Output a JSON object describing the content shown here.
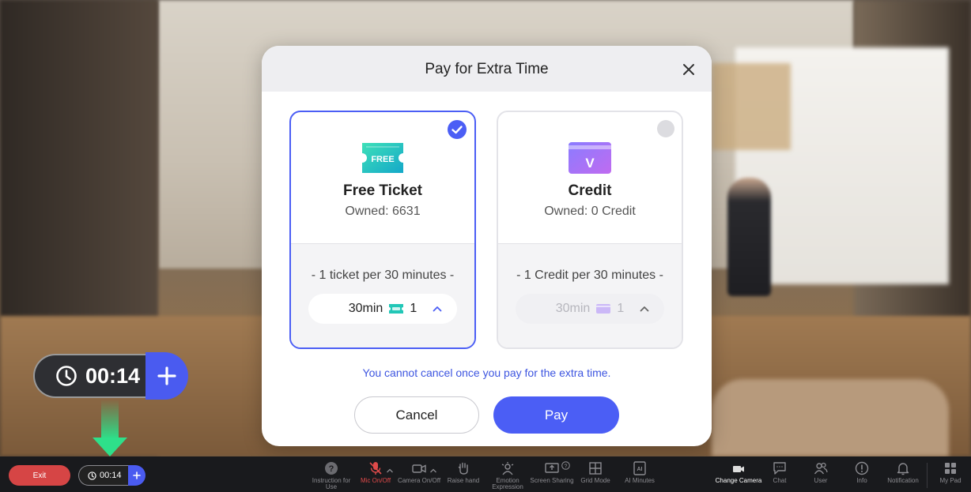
{
  "modal": {
    "title": "Pay for Extra Time",
    "options": [
      {
        "icon": "free-ticket-icon",
        "badge": "FREE",
        "name": "Free Ticket",
        "owned": "Owned: 6631",
        "rate": "- 1 ticket per 30 minutes -",
        "duration": "30min",
        "quantity": "1",
        "selected": true
      },
      {
        "icon": "credit-icon",
        "badge": "V",
        "name": "Credit",
        "owned": "Owned: 0 Credit",
        "rate": "- 1 Credit per 30 minutes -",
        "duration": "30min",
        "quantity": "1",
        "selected": false
      }
    ],
    "warning": "You cannot cancel once you pay for the extra time.",
    "cancel_label": "Cancel",
    "pay_label": "Pay"
  },
  "timer_overlay": {
    "time": "00:14"
  },
  "toolbar": {
    "exit_label": "Exit",
    "timer": "00:14",
    "tools": [
      {
        "name": "instruction",
        "label": "Instruction for Use"
      },
      {
        "name": "mic",
        "label": "Mic On/Off"
      },
      {
        "name": "camera",
        "label": "Camera On/Off"
      },
      {
        "name": "raise-hand",
        "label": "Raise hand"
      },
      {
        "name": "emotion",
        "label": "Emotion Expression"
      },
      {
        "name": "screen-sharing",
        "label": "Screen Sharing"
      },
      {
        "name": "grid-mode",
        "label": "Grid Mode"
      },
      {
        "name": "ai-minutes",
        "label": "AI Minutes"
      },
      {
        "name": "change-camera",
        "label": "Change Camera"
      },
      {
        "name": "chat",
        "label": "Chat"
      },
      {
        "name": "user",
        "label": "User"
      },
      {
        "name": "info",
        "label": "Info"
      },
      {
        "name": "notification",
        "label": "Notification"
      },
      {
        "name": "my-pad",
        "label": "My Pad"
      }
    ]
  },
  "colors": {
    "accent": "#4b5ef5",
    "exit": "#d64545",
    "toolbar": "#191a1d",
    "mic_off": "#e04a4a"
  }
}
